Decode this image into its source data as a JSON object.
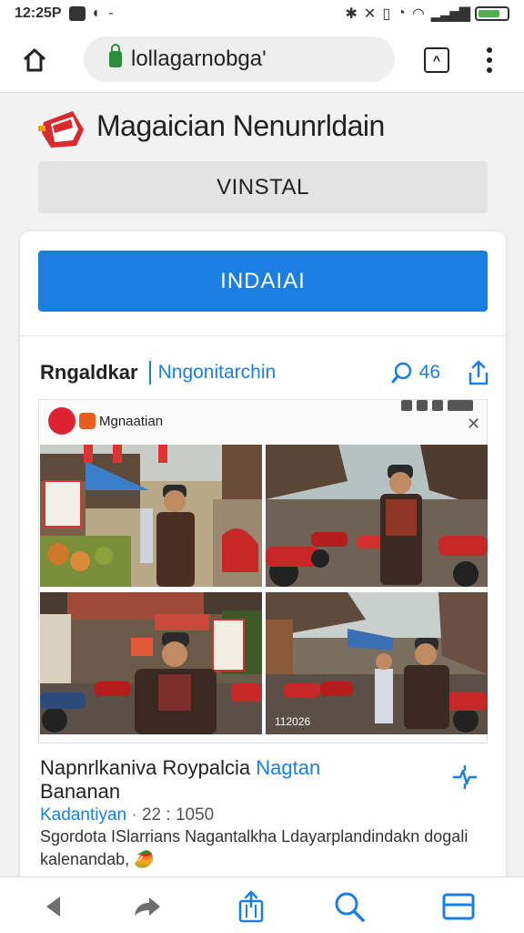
{
  "status_bar": {
    "time": "12:25P",
    "icons": [
      "signal-icon",
      "wifi-icon",
      "battery-icon"
    ],
    "battery_level": 0.75
  },
  "browser": {
    "url": "lollagarnobga'",
    "tab_count": "^",
    "accent": "#1a7fe0"
  },
  "app": {
    "title": "Magaician Nenunrldain",
    "install_gray_label": "VINSTAL",
    "install_blue_label": "INDAIAI"
  },
  "post": {
    "author": "Rngaldkar",
    "category": "Nngonitarchin",
    "comment_count": "46",
    "inner_title": "Mgnaatian",
    "title_plain": "Napnrlkaniva Roypalcia ",
    "title_link": "Nagtan",
    "title_line2": "Bananan",
    "meta_place": "Kadantiyan",
    "meta_sep": "·",
    "meta_time": "22 : 1050",
    "description": "Sgordota ISlarrians Nagantalkha Ldayarplandindakn dogali kalenandab,",
    "emoji": "🥭",
    "photo_stamp": "112026"
  }
}
